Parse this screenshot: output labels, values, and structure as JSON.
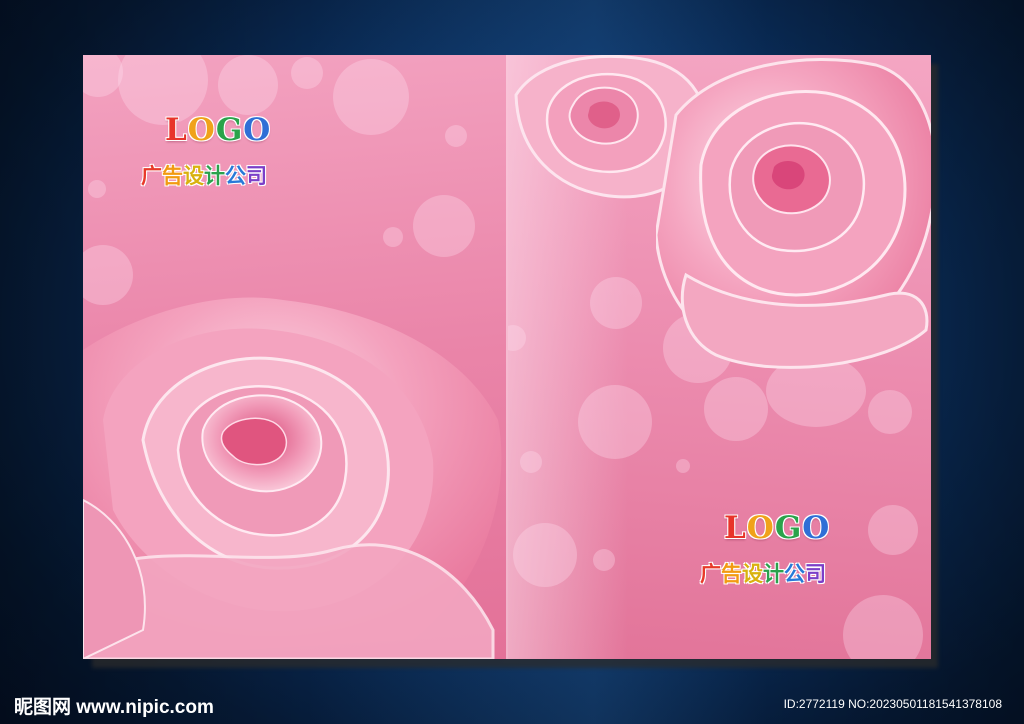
{
  "left_panel": {
    "logo_letters": [
      "L",
      "O",
      "G",
      "O"
    ],
    "company_chars": [
      "广",
      "告",
      "设",
      "计",
      "公",
      "司"
    ]
  },
  "right_panel": {
    "logo_letters": [
      "L",
      "O",
      "G",
      "O"
    ],
    "company_chars": [
      "广",
      "告",
      "设",
      "计",
      "公",
      "司"
    ]
  },
  "watermark": {
    "site": "昵图网 www.nipic.com",
    "id_text": "ID:2772119 NO:20230501181541378108"
  },
  "colors": {
    "brochure_pink": "#ec8caf",
    "rose_pink": "#f08fb0",
    "background_blue": "#0a2f5e"
  }
}
